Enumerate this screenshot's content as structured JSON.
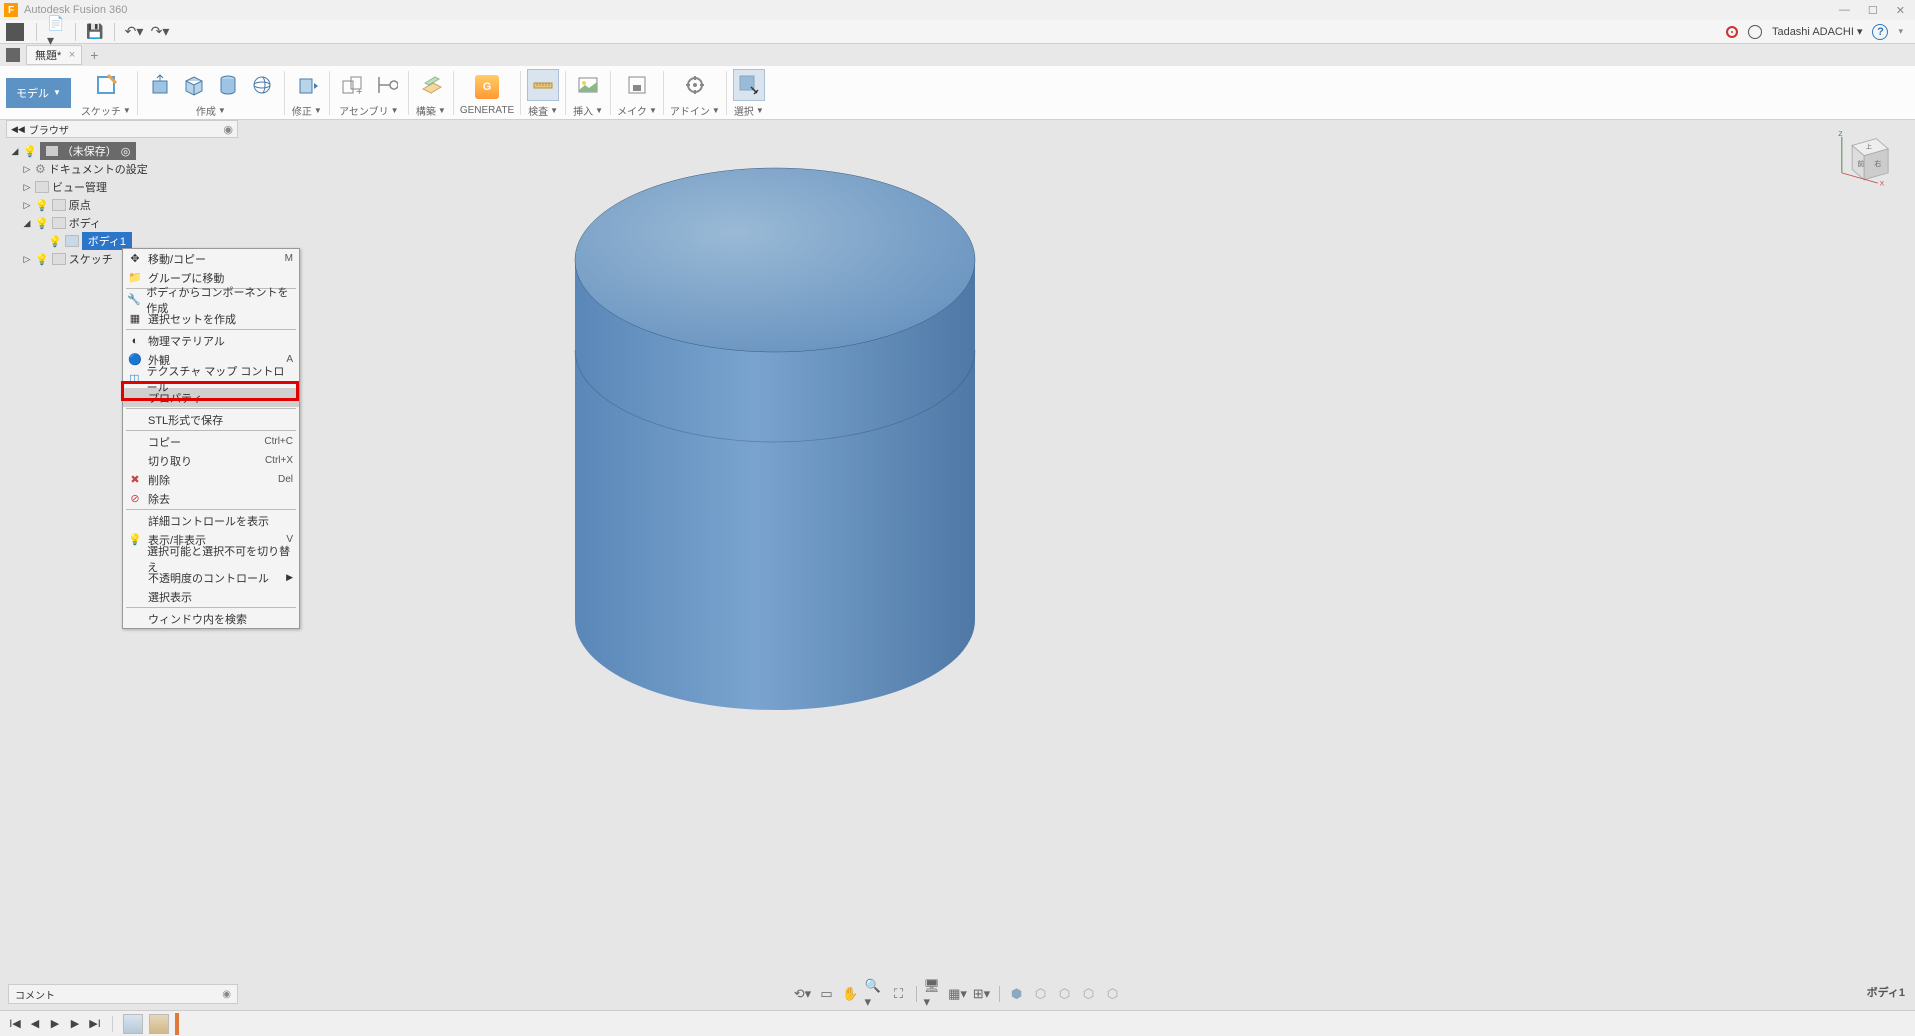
{
  "app": {
    "title": "Autodesk Fusion 360"
  },
  "user": {
    "name": "Tadashi ADACHI"
  },
  "document": {
    "tab_title": "無題*"
  },
  "toolbar": {
    "workspace": "モデル",
    "groups": [
      {
        "label": "スケッチ"
      },
      {
        "label": "作成"
      },
      {
        "label": "修正"
      },
      {
        "label": "アセンブリ"
      },
      {
        "label": "構築"
      },
      {
        "label": "GENERATE"
      },
      {
        "label": "検査"
      },
      {
        "label": "挿入"
      },
      {
        "label": "メイク"
      },
      {
        "label": "アドイン"
      },
      {
        "label": "選択"
      }
    ]
  },
  "browser": {
    "title": "ブラウザ",
    "root": "（未保存）",
    "nodes": {
      "doc_settings": "ドキュメントの設定",
      "views": "ビュー管理",
      "origin": "原点",
      "bodies": "ボディ",
      "body1": "ボディ1",
      "sketches": "スケッチ"
    }
  },
  "context_menu": {
    "items": [
      {
        "label": "移動/コピー",
        "shortcut": "M",
        "icon": "move"
      },
      {
        "label": "グループに移動",
        "icon": "group"
      },
      {
        "label": "ボディからコンポーネントを作成",
        "icon": "comp"
      },
      {
        "label": "選択セットを作成",
        "icon": "selset"
      },
      {
        "label": "物理マテリアル",
        "icon": "mat"
      },
      {
        "label": "外観",
        "shortcut": "A",
        "icon": "appear"
      },
      {
        "label": "テクスチャ マップ コントロール",
        "icon": "tex"
      },
      {
        "label": "プロパティ",
        "highlighted": true
      },
      {
        "label": "STL形式で保存"
      },
      {
        "label": "コピー",
        "shortcut": "Ctrl+C"
      },
      {
        "label": "切り取り",
        "shortcut": "Ctrl+X"
      },
      {
        "label": "削除",
        "shortcut": "Del",
        "icon": "del"
      },
      {
        "label": "除去",
        "icon": "remove"
      },
      {
        "label": "詳細コントロールを表示"
      },
      {
        "label": "表示/非表示",
        "shortcut": "V",
        "icon": "bulb"
      },
      {
        "label": "選択可能と選択不可を切り替え"
      },
      {
        "label": "不透明度のコントロール",
        "submenu": true
      },
      {
        "label": "選択表示"
      },
      {
        "label": "ウィンドウ内を検索"
      }
    ]
  },
  "comment": {
    "label": "コメント"
  },
  "status": {
    "right": "ボディ1"
  }
}
